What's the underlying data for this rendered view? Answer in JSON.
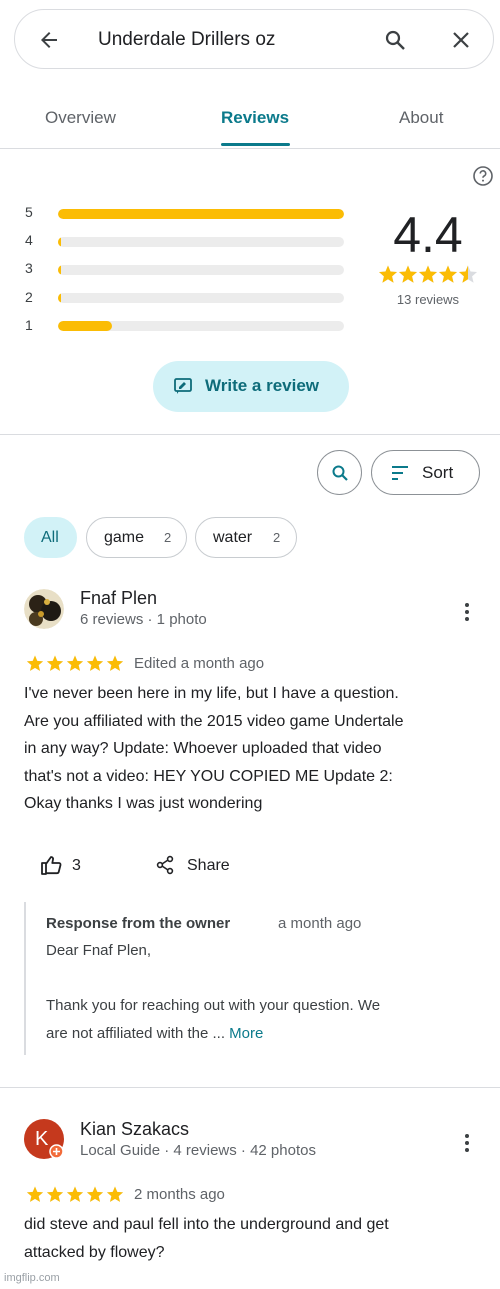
{
  "search": {
    "query": "Underdale Drillers oz"
  },
  "tabs": [
    {
      "label": "Overview"
    },
    {
      "label": "Reviews"
    },
    {
      "label": "About"
    }
  ],
  "summary": {
    "rating": "4.4",
    "stars": 4.5,
    "count_label": "13 reviews",
    "bars": [
      {
        "label": "5",
        "fraction": 1.0
      },
      {
        "label": "4",
        "fraction": 0.01
      },
      {
        "label": "3",
        "fraction": 0.01
      },
      {
        "label": "2",
        "fraction": 0.01
      },
      {
        "label": "1",
        "fraction": 0.19
      }
    ],
    "write_review_label": "Write a review"
  },
  "controls": {
    "sort_label": "Sort"
  },
  "chips": [
    {
      "label": "All",
      "count": ""
    },
    {
      "label": "game",
      "count": "2"
    },
    {
      "label": "water",
      "count": "2"
    }
  ],
  "reviews": [
    {
      "name": "Fnaf Plen",
      "meta": "6 reviews · 1 photo",
      "stars": 5,
      "when": "Edited a month ago",
      "lines": [
        "I've never been here in my life, but I have a question.",
        "Are you affiliated with the 2015 video game Undertale",
        "in any way? Update: Whoever uploaded that video",
        "that's not a video: HEY YOU COPIED ME Update 2:",
        "Okay thanks I was just wondering"
      ],
      "likes": "3",
      "share_label": "Share",
      "owner": {
        "title": "Response from the owner",
        "when": "a month ago",
        "line1": "Dear Fnaf Plen,",
        "line2": "Thank you for reaching out with your question. We",
        "line3": "are not affiliated with the ...",
        "more": "More"
      }
    },
    {
      "name": "Kian Szakacs",
      "avatar_letter": "K",
      "meta": "Local Guide · 4 reviews · 42 photos",
      "stars": 5,
      "when": "2 months ago",
      "lines": [
        "did steve and paul fell into the underground and get",
        "attacked by flowey?"
      ]
    }
  ],
  "watermark": "imgflip.com",
  "colors": {
    "accent": "#0b7a8b",
    "star": "#fbbc04",
    "chip_selected": "#d2f2f7",
    "avatar2": "#c5391d"
  }
}
